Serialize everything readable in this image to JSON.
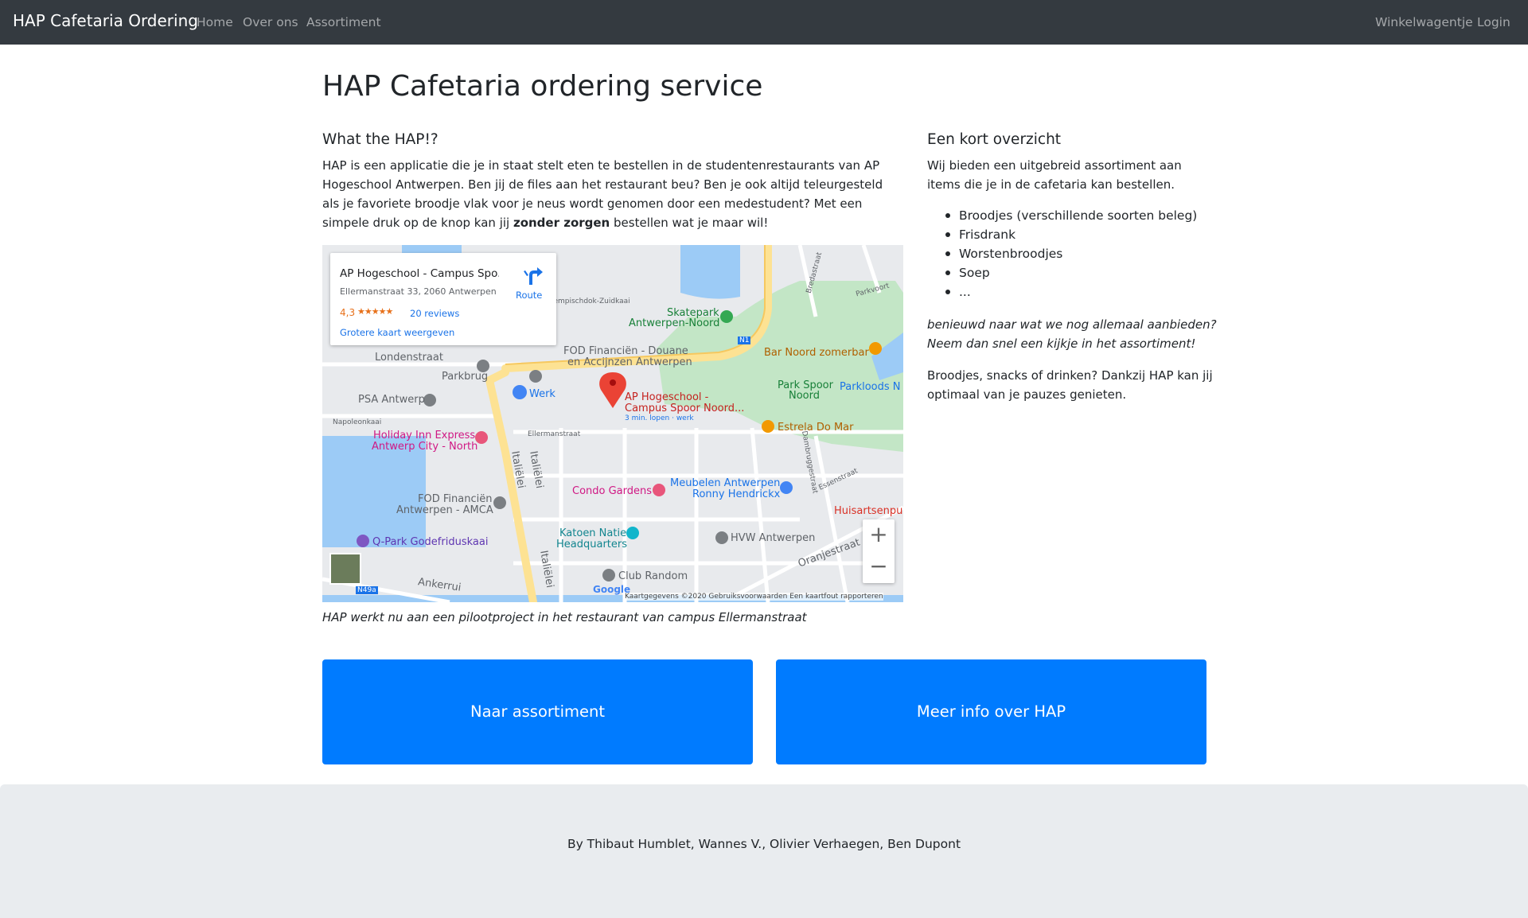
{
  "navbar": {
    "brand": "HAP Cafetaria Ordering",
    "links": [
      "Home",
      "Over ons",
      "Assortiment"
    ],
    "right_links": [
      "Winkelwagentje",
      "Login"
    ]
  },
  "main": {
    "title": "HAP Cafetaria ordering service",
    "left": {
      "heading": "What the HAP!?",
      "intro_before": "HAP is een applicatie die je in staat stelt eten te bestellen in de studentenrestaurants van AP Hogeschool Antwerpen. Ben jij de files aan het restaurant beu? Ben je ook altijd teleurgesteld als je favoriete broodje vlak voor je neus wordt genomen door een medestudent? Met een simpele druk op de knop kan jij ",
      "intro_bold": "zonder zorgen",
      "intro_after": " bestellen wat je maar wil!",
      "map_caption": "HAP werkt nu aan een pilootproject in het restaurant van campus Ellermanstraat"
    },
    "right": {
      "heading": "Een kort overzicht",
      "intro": "Wij bieden een uitgebreid assortiment aan items die je in de cafetaria kan bestellen.",
      "items": [
        "Broodjes (verschillende soorten beleg)",
        "Frisdrank",
        "Worstenbroodjes",
        "Soep",
        "..."
      ],
      "teaser": "benieuwd naar wat we nog allemaal aanbieden? Neem dan snel een kijkje in het assortiment!",
      "closing": "Broodjes, snacks of drinken? Dankzij HAP kan jij optimaal van je pauzes genieten."
    },
    "buttons": {
      "assortment": "Naar assortiment",
      "more_info": "Meer info over HAP"
    }
  },
  "map": {
    "card": {
      "title": "AP Hogeschool - Campus Spo...",
      "address": "Ellermanstraat 33, 2060 Antwerpen",
      "rating": "4,3",
      "stars": "★★★★★",
      "reviews": "20 reviews",
      "larger_map": "Grotere kaart weergeven",
      "route": "Route"
    },
    "labels": {
      "kempisch": "Kempischdok-Zuidkaai",
      "skatepark": "Skatepark",
      "skatepark2": "Antwerpen-Noord",
      "fod1": "FOD Financiën - Douane",
      "fod2": "en Accijnzen Antwerpen",
      "londen": "Londenstraat",
      "parkbrug": "Parkbrug",
      "psa": "PSA Antwerp",
      "werk": "Werk",
      "ap1": "AP Hogeschool -",
      "ap2": "Campus Spoor Noord...",
      "ap3": "3 min. lopen · werk",
      "barnoord": "Bar Noord zomerbar",
      "parkspoor1": "Park Spoor",
      "parkspoor2": "Noord",
      "parkloods": "Parkloods N",
      "estrela": "Estrela Do Mar",
      "napoleon": "Napoleonkaai",
      "holiday1": "Holiday Inn Express",
      "holiday2": "Antwerp City - North",
      "ellerman": "Ellermanstraat",
      "italie1": "Italiëlei",
      "italie2": "Italiëlei",
      "italie3": "Italiëlei",
      "condo": "Condo Gardens",
      "meubelen1": "Meubelen Antwerpen",
      "meubelen2": "Ronny Hendrickx",
      "huisarts": "Huisartsenpun",
      "fodamca1": "FOD Financiën",
      "fodamca2": "Antwerpen - AMCA",
      "katoen1": "Katoen Natie",
      "katoen2": "Headquarters",
      "hvw": "HVW Antwerpen",
      "qpark": "Q-Park Godefriduskaai",
      "clubrandom": "Club Random",
      "ankerrui": "Ankerrui",
      "oranje": "Oranjestraat",
      "essen": "Essenstraat",
      "damb": "Dambruggestraat",
      "bredastr": "Bredastraat",
      "parkvoort": "Parkvoort",
      "n1": "N1",
      "n49a": "N49a",
      "zoom_in": "+",
      "zoom_out": "−",
      "footer": "Kaartgegevens ©2020   Gebruiksvoorwaarden   Een kaartfout rapporteren",
      "google": "Google"
    }
  },
  "footer": {
    "credits": "By Thibaut Humblet, Wannes V., Olivier Verhaegen, Ben Dupont"
  },
  "colors": {
    "navbar": "#343a40",
    "primary": "#007bff",
    "footer": "#e9ecef"
  }
}
